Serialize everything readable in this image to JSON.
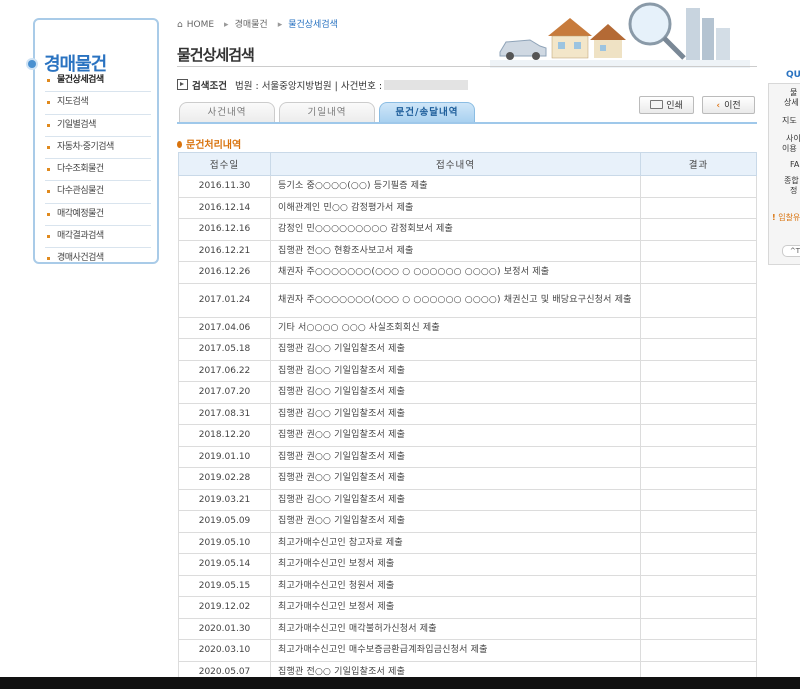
{
  "sidebar": {
    "title": "경매물건",
    "items": [
      {
        "label": "물건상세검색",
        "active": true
      },
      {
        "label": "지도검색"
      },
      {
        "label": "기일별검색"
      },
      {
        "label": "자동차·중기검색"
      },
      {
        "label": "다수조회물건"
      },
      {
        "label": "다수관심물건"
      },
      {
        "label": "매각예정물건"
      },
      {
        "label": "매각결과검색"
      },
      {
        "label": "경매사건검색"
      }
    ]
  },
  "breadcrumb": {
    "home": "HOME",
    "level1": "경매물건",
    "current": "물건상세검색"
  },
  "page_title": "물건상세검색",
  "search": {
    "label": "검색조건",
    "court": "법원 : 서울중앙지방법원",
    "divider": "|",
    "case_label": "사건번호 :"
  },
  "tabs": [
    {
      "label": "사건내역"
    },
    {
      "label": "기일내역"
    },
    {
      "label": "문건/송달내역",
      "active": true
    }
  ],
  "buttons": {
    "print": "인쇄",
    "back": "이전"
  },
  "section_title": "문건처리내역",
  "table": {
    "headers": [
      "접수일",
      "접수내역",
      "결과"
    ],
    "rows": [
      {
        "date": "2016.11.30",
        "content": "등기소 중○○○○(○○) 등기필증 제출",
        "result": ""
      },
      {
        "date": "2016.12.14",
        "content": "이해관계인 민○○ 감정평가서 제출",
        "result": ""
      },
      {
        "date": "2016.12.16",
        "content": "감정인 민○○○○○○○○○ 감정회보서 제출",
        "result": ""
      },
      {
        "date": "2016.12.21",
        "content": "집행관 전○○ 현황조사보고서 제출",
        "result": ""
      },
      {
        "date": "2016.12.26",
        "content": "채권자 주○○○○○○○(○○○ ○ ○○○○○○ ○○○○) 보정서 제출",
        "result": ""
      },
      {
        "date": "2017.01.24",
        "content": "채권자 주○○○○○○○(○○○ ○ ○○○○○○ ○○○○) 채권신고 및 배당요구신청서 제출",
        "result": "",
        "tall": true
      },
      {
        "date": "2017.04.06",
        "content": "기타 서○○○○ ○○○ 사실조회회신 제출",
        "result": ""
      },
      {
        "date": "2017.05.18",
        "content": "집행관 김○○ 기일입찰조서 제출",
        "result": ""
      },
      {
        "date": "2017.06.22",
        "content": "집행관 김○○ 기일입찰조서 제출",
        "result": ""
      },
      {
        "date": "2017.07.20",
        "content": "집행관 김○○ 기일입찰조서 제출",
        "result": ""
      },
      {
        "date": "2017.08.31",
        "content": "집행관 김○○ 기일입찰조서 제출",
        "result": ""
      },
      {
        "date": "2018.12.20",
        "content": "집행관 권○○ 기일입찰조서 제출",
        "result": ""
      },
      {
        "date": "2019.01.10",
        "content": "집행관 권○○ 기일입찰조서 제출",
        "result": ""
      },
      {
        "date": "2019.02.28",
        "content": "집행관 권○○ 기일입찰조서 제출",
        "result": ""
      },
      {
        "date": "2019.03.21",
        "content": "집행관 김○○ 기일입찰조서 제출",
        "result": ""
      },
      {
        "date": "2019.05.09",
        "content": "집행관 권○○ 기일입찰조서 제출",
        "result": ""
      },
      {
        "date": "2019.05.10",
        "content": "최고가매수신고인 참고자료 제출",
        "result": ""
      },
      {
        "date": "2019.05.14",
        "content": "최고가매수신고인 보정서 제출",
        "result": ""
      },
      {
        "date": "2019.05.15",
        "content": "최고가매수신고인 청원서 제출",
        "result": ""
      },
      {
        "date": "2019.12.02",
        "content": "최고가매수신고인 보정서 제출",
        "result": ""
      },
      {
        "date": "2020.01.30",
        "content": "최고가매수신고인 매각불허가신청서 제출",
        "result": ""
      },
      {
        "date": "2020.03.10",
        "content": "최고가매수신고인 매수보증금환급계좌입금신청서 제출",
        "result": ""
      },
      {
        "date": "2020.05.07",
        "content": "집행관 전○○ 기일입찰조서 제출",
        "result": ""
      }
    ]
  },
  "quick": {
    "head": "QUI",
    "items": [
      "물",
      "상세",
      "지도",
      "사이",
      "이용",
      "FA",
      "종합",
      "정"
    ],
    "warning": "입찰유의",
    "top": "^T"
  },
  "colors": {
    "accent_blue": "#2a73c1",
    "accent_orange": "#d9730d",
    "header_bg": "#e8f1fa"
  }
}
